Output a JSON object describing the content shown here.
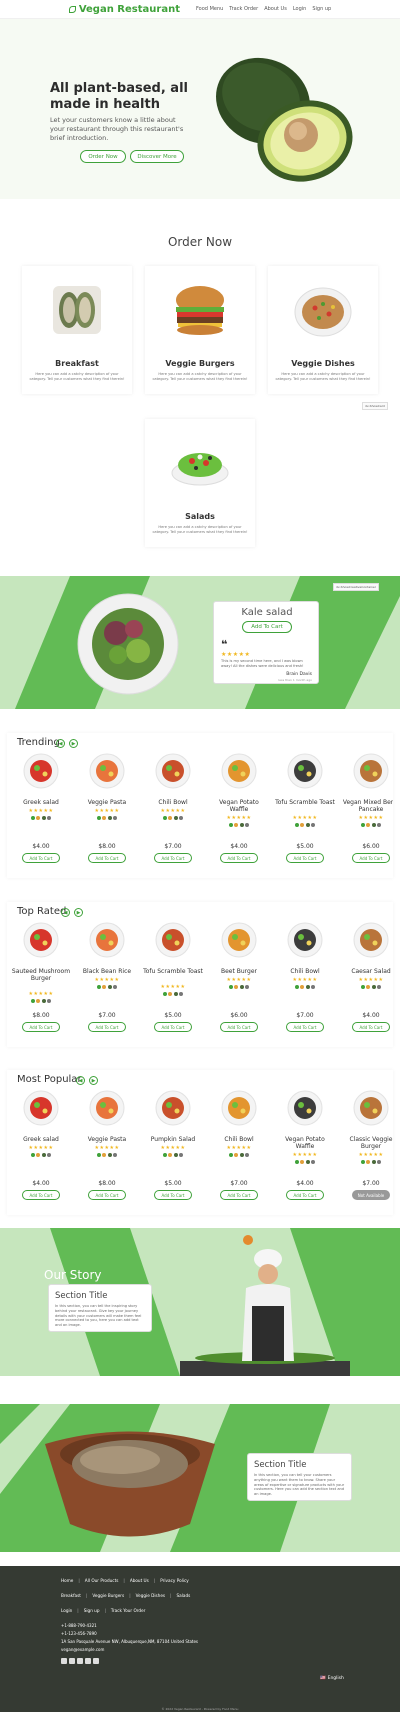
{
  "nav": {
    "brand": "Vegan Restaurant",
    "links": [
      "Food Menu",
      "Track Order",
      "About Us",
      "Login",
      "Sign up"
    ]
  },
  "hero": {
    "title": "All plant-based, all made in health",
    "subtitle": "Let your customers know a little about your restaurant through this restaurant's brief introduction.",
    "order_button": "Order Now",
    "discover_button": "Discover More"
  },
  "order": {
    "title": "Order Now",
    "categories": [
      {
        "name": "Breakfast",
        "desc": "Here you can add a catchy description of your category. Tell your customers what they find therein!"
      },
      {
        "name": "Veggie Burgers",
        "desc": "Here you can add a catchy description of your category. Tell your customers what they find therein!"
      },
      {
        "name": "Veggie Dishes",
        "desc": "Here you can add a catchy description of your category. Tell your customers what they find therein!"
      },
      {
        "name": "Salads",
        "desc": "Here you can add a catchy description of your category. Tell your customers what they find therein!"
      }
    ],
    "tag_label": "dv-ShowCard"
  },
  "review": {
    "tag_label": "dv-ShowCreativeContainer",
    "title": "Kale salad",
    "button": "Add To Cart",
    "rating": 5,
    "text": "This is my second time here, and I was blown away! All the dishes were delicious and fresh!",
    "author": "Brain Davis",
    "when": "less than 1 month ago"
  },
  "trending": {
    "title": "Trending",
    "products": [
      {
        "name": "Greek salad",
        "price": "$4.00",
        "rating": 5,
        "button": "Add To Cart"
      },
      {
        "name": "Veggie Pasta",
        "price": "$8.00",
        "rating": 5,
        "button": "Add To Cart"
      },
      {
        "name": "Chili Bowl",
        "price": "$7.00",
        "rating": 5,
        "button": "Add To Cart"
      },
      {
        "name": "Vegan Potato Waffle",
        "price": "$4.00",
        "rating": 5,
        "button": "Add To Cart"
      },
      {
        "name": "Tofu Scramble Toast",
        "price": "$5.00",
        "rating": 5,
        "button": "Add To Cart"
      },
      {
        "name": "Vegan Mixed Berry Pancake",
        "price": "$6.00",
        "rating": 5,
        "button": "Add To Cart"
      }
    ]
  },
  "top_rated": {
    "title": "Top Rated",
    "products": [
      {
        "name": "Sauteed Mushroom Burger",
        "price": "$8.00",
        "rating": 5,
        "button": "Add To Cart"
      },
      {
        "name": "Black Bean Rice",
        "price": "$7.00",
        "rating": 5,
        "button": "Add To Cart"
      },
      {
        "name": "Tofu Scramble Toast",
        "price": "$5.00",
        "rating": 5,
        "button": "Add To Cart"
      },
      {
        "name": "Beet Burger",
        "price": "$6.00",
        "rating": 5,
        "button": "Add To Cart"
      },
      {
        "name": "Chili Bowl",
        "price": "$7.00",
        "rating": 5,
        "button": "Add To Cart"
      },
      {
        "name": "Caesar Salad",
        "price": "$4.00",
        "rating": 5,
        "button": "Add To Cart"
      }
    ]
  },
  "most_popular": {
    "title": "Most Popular",
    "products": [
      {
        "name": "Greek salad",
        "price": "$4.00",
        "rating": 5,
        "button": "Add To Cart"
      },
      {
        "name": "Veggie Pasta",
        "price": "$8.00",
        "rating": 5,
        "button": "Add To Cart"
      },
      {
        "name": "Pumpkin Salad",
        "price": "$5.00",
        "rating": 5,
        "button": "Add To Cart"
      },
      {
        "name": "Chili Bowl",
        "price": "$7.00",
        "rating": 5,
        "button": "Add To Cart"
      },
      {
        "name": "Vegan Potato Waffle",
        "price": "$4.00",
        "rating": 5,
        "button": "Add To Cart"
      },
      {
        "name": "Classic Veggie Burger",
        "price": "$7.00",
        "rating": 5,
        "button": "Not Available"
      }
    ]
  },
  "story": {
    "title": "Our Story",
    "card_title": "Section Title",
    "card_text": "In this section, you can tell the inspiring story behind your restaurant. Give key your journey details with your customers will make them feel more connected to you, here you can add text and an image."
  },
  "section2": {
    "card_title": "Section Title",
    "card_text": "In this section, you can tell your customers anything you want them to know. Share your areas of expertise or signature products with your customers. Here you can add the section text and an image."
  },
  "footer": {
    "row1": [
      "Home",
      "All Our Products",
      "About Us",
      "Privacy Policy"
    ],
    "row2": [
      "Breakfast",
      "Veggie Burgers",
      "Veggie Dishes",
      "Salads"
    ],
    "row3": [
      "Login",
      "Sign up",
      "Track Your Order"
    ],
    "phone1": "+1-888-790-4321",
    "phone2": "+1-123-456-7890",
    "address": "1A San Pasquale Avenue NW, Albuquerque,NM, 87104 United States",
    "email": "vegan@example.com",
    "language": "English",
    "copyright": "© 2022 Vegan Restaurant - Powered by Food Menu"
  },
  "colors": {
    "brand_green": "#3fa23a",
    "light_green": "#c6e6bd",
    "mid_green": "#62bb55",
    "footer_bg": "#353a33",
    "star": "#f1b821"
  }
}
